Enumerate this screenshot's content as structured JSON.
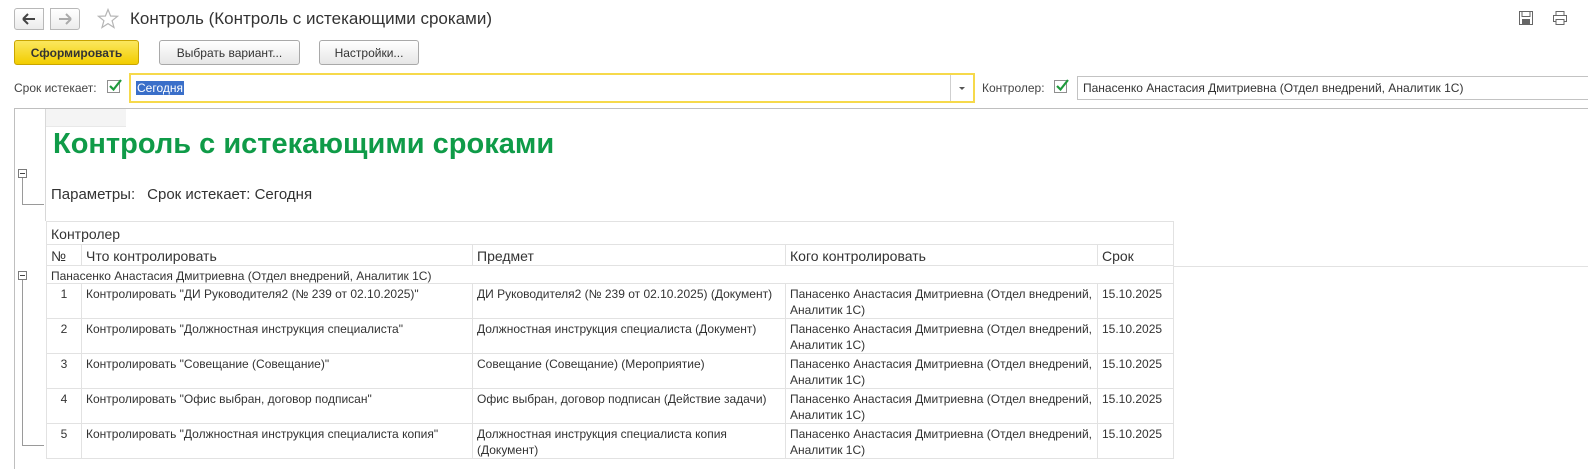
{
  "window": {
    "title": "Контроль (Контроль с истекающими сроками)"
  },
  "toolbar": {
    "generate_label": "Сформировать",
    "variant_label": "Выбрать вариант...",
    "settings_label": "Настройки..."
  },
  "filters": {
    "deadline_label": "Срок истекает:",
    "deadline_checked": true,
    "deadline_value": "Сегодня",
    "controller_label": "Контролер:",
    "controller_checked": true,
    "controller_value": "Панасенко Анастасия Дмитриевна (Отдел внедрений, Аналитик 1С)"
  },
  "report": {
    "title": "Контроль с истекающими сроками",
    "params_label": "Параметры:",
    "params_value": "Срок истекает: Сегодня",
    "group_header": "Контролер",
    "columns": {
      "num": "№",
      "what": "Что контролировать",
      "subject": "Предмет",
      "whom": "Кого контролировать",
      "deadline": "Срок"
    },
    "group_name": "Панасенко Анастасия Дмитриевна (Отдел внедрений, Аналитик 1С)",
    "rows": [
      {
        "num": "1",
        "what": "Контролировать \"ДИ Руководителя2 (№ 239 от 02.10.2025)\"",
        "subject": "ДИ Руководителя2 (№ 239 от 02.10.2025) (Документ)",
        "whom": "Панасенко Анастасия Дмитриевна (Отдел внедрений, Аналитик 1С)",
        "deadline": "15.10.2025"
      },
      {
        "num": "2",
        "what": "Контролировать \"Должностная инструкция специалиста\"",
        "subject": "Должностная инструкция специалиста (Документ)",
        "whom": "Панасенко Анастасия Дмитриевна (Отдел внедрений, Аналитик 1С)",
        "deadline": "15.10.2025"
      },
      {
        "num": "3",
        "what": "Контролировать \"Совещание (Совещание)\"",
        "subject": "Совещание  (Совещание) (Мероприятие)",
        "whom": "Панасенко Анастасия Дмитриевна (Отдел внедрений, Аналитик 1С)",
        "deadline": "15.10.2025"
      },
      {
        "num": "4",
        "what": "Контролировать \"Офис выбран, договор подписан\"",
        "subject": "Офис выбран, договор подписан (Действие задачи)",
        "whom": "Панасенко Анастасия Дмитриевна (Отдел внедрений, Аналитик 1С)",
        "deadline": "15.10.2025"
      },
      {
        "num": "5",
        "what": "Контролировать \"Должностная инструкция специалиста копия\"",
        "subject": "Должностная инструкция специалиста копия (Документ)",
        "whom": "Панасенко Анастасия Дмитриевна (Отдел внедрений, Аналитик 1С)",
        "deadline": "15.10.2025"
      }
    ]
  },
  "colors": {
    "title_green": "#0f9b48",
    "primary_button": "#f2cd00",
    "focus_border": "#f6d94b",
    "selection": "#3a6fc9",
    "checkmark": "#1f9a3d"
  }
}
